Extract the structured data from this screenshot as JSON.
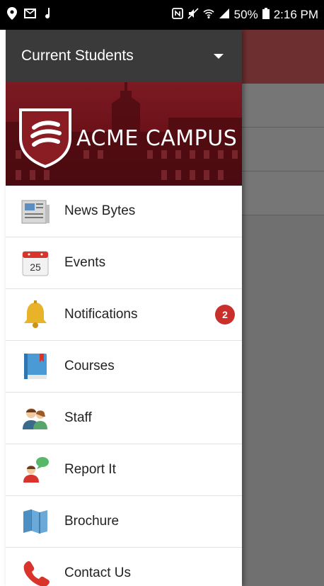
{
  "status_bar": {
    "left_icons": [
      "location-pin-icon",
      "mail-icon",
      "music-note-icon"
    ],
    "right_icons": [
      "nfc-icon",
      "mute-icon",
      "wifi-icon",
      "signal-icon",
      "battery-icon"
    ],
    "battery": "50%",
    "time": "2:16 PM"
  },
  "header": {
    "title": "Current Students"
  },
  "banner": {
    "title": "ACME CAMPUS"
  },
  "menu": {
    "items": [
      {
        "label": "News Bytes",
        "icon": "newspaper-icon"
      },
      {
        "label": "Events",
        "icon": "calendar-icon",
        "icon_text": "25"
      },
      {
        "label": "Notifications",
        "icon": "bell-icon",
        "badge": "2"
      },
      {
        "label": "Courses",
        "icon": "book-icon"
      },
      {
        "label": "Staff",
        "icon": "people-icon"
      },
      {
        "label": "Report It",
        "icon": "speech-person-icon"
      },
      {
        "label": "Brochure",
        "icon": "map-icon"
      },
      {
        "label": "Contact Us",
        "icon": "phone-icon"
      }
    ]
  },
  "colors": {
    "header_bg": "#3a3a3a",
    "banner_red": "#7c1a22",
    "badge_red": "#c9302c",
    "overlay_gray": "#707070"
  }
}
